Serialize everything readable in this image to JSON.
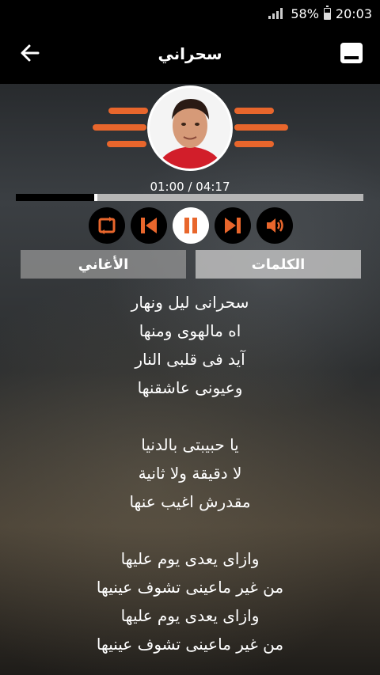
{
  "status": {
    "battery": "58%",
    "time": "20:03"
  },
  "appbar": {
    "title": "سحراني",
    "back_icon": "arrow-left-icon",
    "minimize_icon": "minimize-icon"
  },
  "player": {
    "time_display": "01:00 / 04:17",
    "progress": 0.235,
    "accent": "#e8662c"
  },
  "tabs": {
    "songs": "الأغاني",
    "lyrics": "الكلمات"
  },
  "lyrics": {
    "l1": "سحرانى ليل ونهار",
    "l2": "اه مالهوى ومنها",
    "l3": "آيد فى قلبى النار",
    "l4": "وعيونى عاشقنها",
    "l5": "يا حبيبتى بالدنيا",
    "l6": "لا دقيقة ولا ثانية",
    "l7": "مقدرش اغيب عنها",
    "l8": "وازاى يعدى يوم عليها",
    "l9": "من غير ماعينى تشوف عينيها",
    "l10": "وازاى يعدى يوم عليها",
    "l11": "من غير ماعينى تشوف عينيها"
  }
}
